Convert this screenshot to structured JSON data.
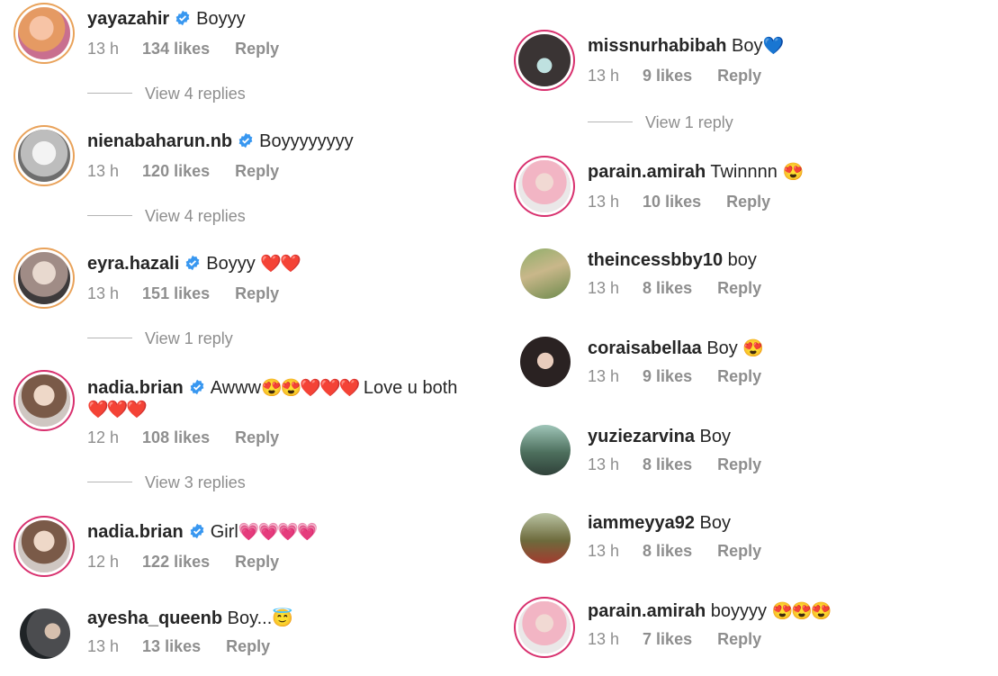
{
  "left_comments": [
    {
      "username": "yayazahir",
      "verified": true,
      "text": "Boyyy",
      "emoji": "",
      "time": "13 h",
      "likes": "134 likes",
      "reply": "Reply",
      "view": "View 4 replies"
    },
    {
      "username": "nienabaharun.nb",
      "verified": true,
      "text": "Boyyyyyyyy",
      "emoji": "",
      "time": "13 h",
      "likes": "120 likes",
      "reply": "Reply",
      "view": "View 4 replies"
    },
    {
      "username": "eyra.hazali",
      "verified": true,
      "text": "Boyyy",
      "emoji": "❤️❤️",
      "time": "13 h",
      "likes": "151 likes",
      "reply": "Reply",
      "view": "View 1 reply"
    },
    {
      "username": "nadia.brian",
      "verified": true,
      "text": "Awww",
      "emoji": "😍😍❤️❤️❤️",
      "text2": "Love u both",
      "line2": "❤️❤️❤️",
      "time": "12 h",
      "likes": "108 likes",
      "reply": "Reply",
      "view": "View 3 replies"
    },
    {
      "username": "nadia.brian",
      "verified": true,
      "text": "Girl",
      "emoji": "💗💗💗💗",
      "time": "12 h",
      "likes": "122 likes",
      "reply": "Reply",
      "view": ""
    },
    {
      "username": "ayesha_queenb",
      "verified": false,
      "text": "Boy...",
      "emoji": "😇",
      "time": "13 h",
      "likes": "13 likes",
      "reply": "Reply",
      "view": ""
    }
  ],
  "right_comments": [
    {
      "username": "missnurhabibah",
      "text": "Boy",
      "emoji": "💙",
      "time": "13 h",
      "likes": "9 likes",
      "reply": "Reply",
      "view": "View 1 reply"
    },
    {
      "username": "parain.amirah",
      "text": "Twinnnn",
      "emoji": "😍",
      "time": "13 h",
      "likes": "10 likes",
      "reply": "Reply",
      "view": ""
    },
    {
      "username": "theincessbby10",
      "text": "boy",
      "emoji": "",
      "time": "13 h",
      "likes": "8 likes",
      "reply": "Reply",
      "view": ""
    },
    {
      "username": "coraisabellaa",
      "text": "Boy",
      "emoji": "😍",
      "time": "13 h",
      "likes": "9 likes",
      "reply": "Reply",
      "view": ""
    },
    {
      "username": "yuziezarvina",
      "text": "Boy",
      "emoji": "",
      "time": "13 h",
      "likes": "8 likes",
      "reply": "Reply",
      "view": ""
    },
    {
      "username": "iammeyya92",
      "text": "Boy",
      "emoji": "",
      "time": "13 h",
      "likes": "8 likes",
      "reply": "Reply",
      "view": ""
    },
    {
      "username": "parain.amirah",
      "text": "boyyyy",
      "emoji": "😍😍😍",
      "time": "13 h",
      "likes": "7 likes",
      "reply": "Reply",
      "view": ""
    }
  ],
  "colors": {
    "verified": "#3897f0",
    "meta": "#8e8e8e",
    "text": "#262626",
    "story_ring": "#d8306e"
  }
}
